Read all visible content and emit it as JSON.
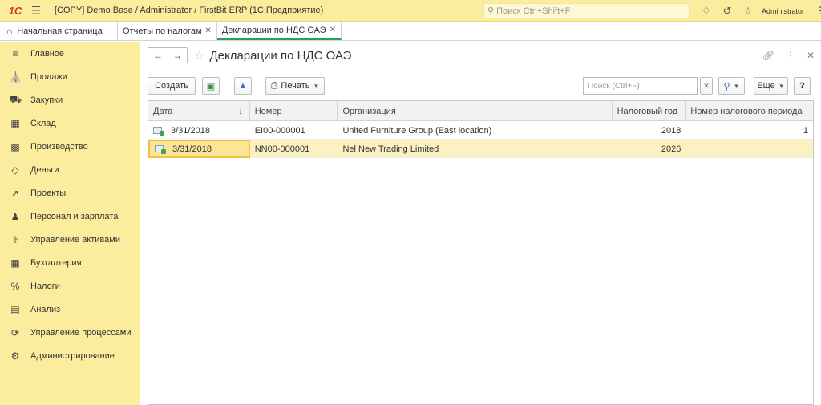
{
  "titlebar": {
    "logo": "1С",
    "title": "[COPY] Demo Base / Administrator / FirstBit ERP  (1С:Предприятие)",
    "search_placeholder": "Поиск Ctrl+Shift+F",
    "user": "Administrator"
  },
  "tabs": {
    "home": "Начальная страница",
    "items": [
      {
        "label": "Отчеты по налогам"
      },
      {
        "label": "Декларации по НДС ОАЭ"
      }
    ]
  },
  "sidebar": {
    "items": [
      {
        "label": "Главное",
        "icon": "menu-icon"
      },
      {
        "label": "Продажи",
        "icon": "shop-icon"
      },
      {
        "label": "Закупки",
        "icon": "truck-icon"
      },
      {
        "label": "Склад",
        "icon": "warehouse-icon"
      },
      {
        "label": "Производство",
        "icon": "factory-icon"
      },
      {
        "label": "Деньги",
        "icon": "money-icon"
      },
      {
        "label": "Проекты",
        "icon": "rocket-icon"
      },
      {
        "label": "Персонал и зарплата",
        "icon": "person-icon"
      },
      {
        "label": "Управление активами",
        "icon": "crane-icon"
      },
      {
        "label": "Бухгалтерия",
        "icon": "ledger-icon"
      },
      {
        "label": "Налоги",
        "icon": "percent-icon"
      },
      {
        "label": "Анализ",
        "icon": "chart-icon"
      },
      {
        "label": "Управление процессами",
        "icon": "cycle-icon"
      },
      {
        "label": "Администрирование",
        "icon": "gear-icon"
      }
    ]
  },
  "page": {
    "title": "Декларации по НДС ОАЭ"
  },
  "toolbar": {
    "create": "Создать",
    "print": "Печать",
    "search_placeholder": "Поиск (Ctrl+F)",
    "more": "Еще",
    "help": "?"
  },
  "table": {
    "columns": [
      "Дата",
      "Номер",
      "Организация",
      "Налоговый год",
      "Номер налогового периода"
    ],
    "rows": [
      {
        "date": "3/31/2018",
        "number": "EI00-000001",
        "org": "United Furniture Group (East location)",
        "year": "2018",
        "period": "1"
      },
      {
        "date": "3/31/2018",
        "number": "NN00-000001",
        "org": "Nel New Trading Limited",
        "year": "2026",
        "period": ""
      }
    ]
  },
  "colors": {
    "sidebar_bg": "#fbed9e",
    "selected_row": "#fcf1c0",
    "active_tab": "#2e9c5a"
  }
}
